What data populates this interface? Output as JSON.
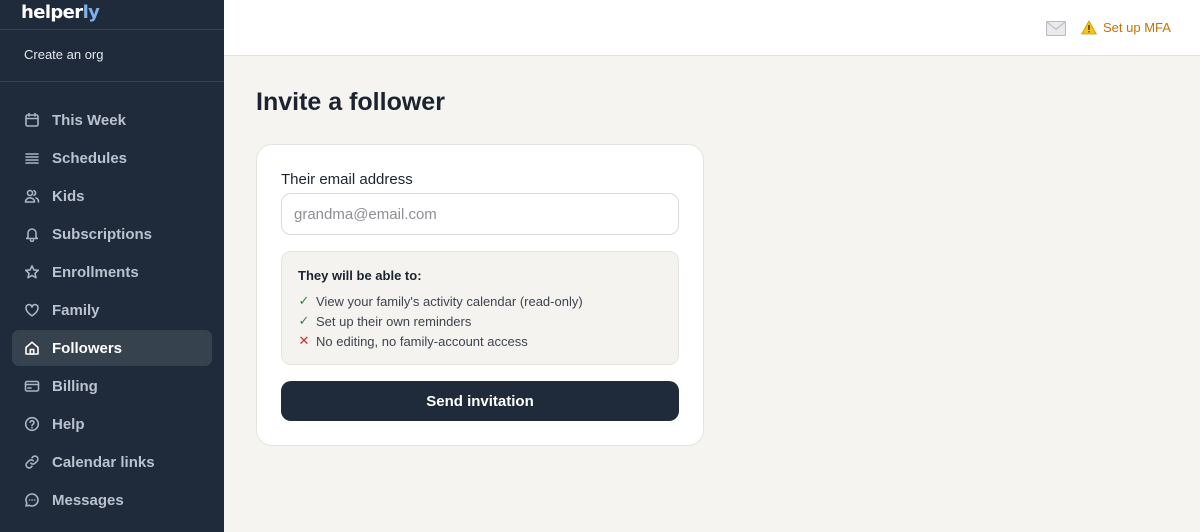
{
  "brand": {
    "logo_main": "helper",
    "logo_accent": "ly"
  },
  "sidebar": {
    "org_link": "Create an org",
    "items": [
      {
        "label": "This Week",
        "icon": "calendar-icon"
      },
      {
        "label": "Schedules",
        "icon": "list-icon"
      },
      {
        "label": "Kids",
        "icon": "users-icon"
      },
      {
        "label": "Subscriptions",
        "icon": "bell-icon"
      },
      {
        "label": "Enrollments",
        "icon": "star-icon"
      },
      {
        "label": "Family",
        "icon": "heart-icon"
      },
      {
        "label": "Followers",
        "icon": "home-icon",
        "active": true
      },
      {
        "label": "Billing",
        "icon": "credit-card-icon"
      },
      {
        "label": "Help",
        "icon": "help-circle-icon"
      },
      {
        "label": "Calendar links",
        "icon": "link-icon"
      },
      {
        "label": "Messages",
        "icon": "message-icon"
      }
    ]
  },
  "topbar": {
    "mfa_label": "Set up MFA",
    "mfa_icon": "warning-icon",
    "mail_icon": "mail-icon"
  },
  "page": {
    "title": "Invite a follower"
  },
  "form": {
    "email_label": "Their email address",
    "email_value": "",
    "email_placeholder": "grandma@email.com",
    "permissions_title": "They will be able to:",
    "permissions": [
      {
        "text": "View your family's activity calendar (read-only)",
        "allowed": true,
        "mark": "✓"
      },
      {
        "text": "Set up their own reminders",
        "allowed": true,
        "mark": "✓"
      },
      {
        "text": "No editing, no family-account access",
        "allowed": false,
        "mark": "✕"
      }
    ],
    "submit_label": "Send invitation"
  },
  "colors": {
    "sidebar_bg": "#1f2a3a",
    "accent_logo": "#7fb2ec",
    "warning": "#c87100",
    "allowed": "#2e8b3e",
    "denied": "#d12d2d",
    "page_bg": "#f5f4f0"
  }
}
